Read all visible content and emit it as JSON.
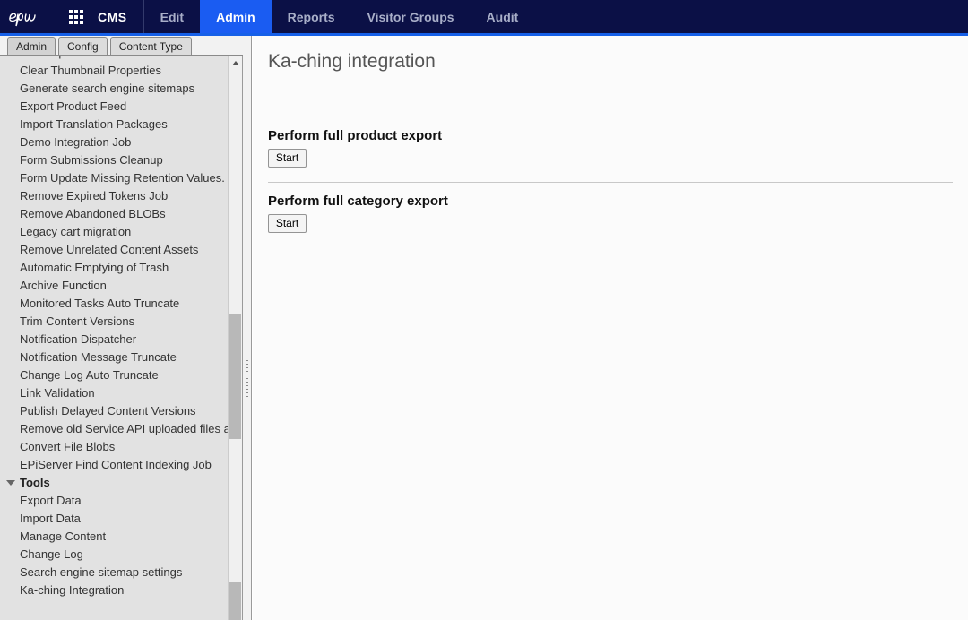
{
  "global_nav": {
    "logo_alt": "epi",
    "grid_icon": "grid-apps-icon",
    "product": "CMS",
    "items": [
      {
        "label": "Edit",
        "active": false
      },
      {
        "label": "Admin",
        "active": true
      },
      {
        "label": "Reports",
        "active": false
      },
      {
        "label": "Visitor Groups",
        "active": false
      },
      {
        "label": "Audit",
        "active": false
      }
    ],
    "accent_color": "#1660e8",
    "background_color": "#0b1046",
    "active_tab_color": "#1a5cf2"
  },
  "left_panel": {
    "tabs": [
      {
        "label": "Admin",
        "active": true
      },
      {
        "label": "Config",
        "active": false
      },
      {
        "label": "Content Type",
        "active": false
      }
    ],
    "tree": [
      {
        "label": "Subscription",
        "type": "item"
      },
      {
        "label": "Clear Thumbnail Properties",
        "type": "item"
      },
      {
        "label": "Generate search engine sitemaps",
        "type": "item"
      },
      {
        "label": "Export Product Feed",
        "type": "item"
      },
      {
        "label": "Import Translation Packages",
        "type": "item"
      },
      {
        "label": "Demo Integration Job",
        "type": "item"
      },
      {
        "label": "Form Submissions Cleanup",
        "type": "item"
      },
      {
        "label": "Form Update Missing Retention Values.",
        "type": "item"
      },
      {
        "label": "Remove Expired Tokens Job",
        "type": "item"
      },
      {
        "label": "Remove Abandoned BLOBs",
        "type": "item"
      },
      {
        "label": "Legacy cart migration",
        "type": "item"
      },
      {
        "label": "Remove Unrelated Content Assets",
        "type": "item"
      },
      {
        "label": "Automatic Emptying of Trash",
        "type": "item"
      },
      {
        "label": "Archive Function",
        "type": "item"
      },
      {
        "label": "Monitored Tasks Auto Truncate",
        "type": "item"
      },
      {
        "label": "Trim Content Versions",
        "type": "item"
      },
      {
        "label": "Notification Dispatcher",
        "type": "item"
      },
      {
        "label": "Notification Message Truncate",
        "type": "item"
      },
      {
        "label": "Change Log Auto Truncate",
        "type": "item"
      },
      {
        "label": "Link Validation",
        "type": "item"
      },
      {
        "label": "Publish Delayed Content Versions",
        "type": "item"
      },
      {
        "label": "Remove old Service API uploaded files and",
        "type": "item"
      },
      {
        "label": "Convert File Blobs",
        "type": "item"
      },
      {
        "label": "EPiServer Find Content Indexing Job",
        "type": "item"
      },
      {
        "label": "Tools",
        "type": "group"
      },
      {
        "label": "Export Data",
        "type": "item"
      },
      {
        "label": "Import Data",
        "type": "item"
      },
      {
        "label": "Manage Content",
        "type": "item"
      },
      {
        "label": "Change Log",
        "type": "item"
      },
      {
        "label": "Search engine sitemap settings",
        "type": "item"
      },
      {
        "label": "Ka-ching Integration",
        "type": "item"
      }
    ]
  },
  "content": {
    "title": "Ka-ching integration",
    "sections": [
      {
        "heading": "Perform full product export",
        "button": "Start"
      },
      {
        "heading": "Perform full category export",
        "button": "Start"
      }
    ]
  }
}
